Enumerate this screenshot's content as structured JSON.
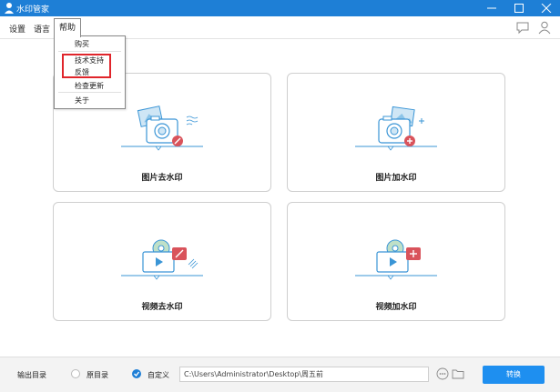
{
  "window": {
    "title": "水印管家"
  },
  "menu": {
    "settings": "设置",
    "language": "语言",
    "help": "帮助",
    "help_items": [
      "购买",
      "技术支持",
      "反馈",
      "检查更新",
      "关于"
    ]
  },
  "cards": [
    {
      "label": "图片去水印",
      "icon": "photo-remove-watermark-icon"
    },
    {
      "label": "图片加水印",
      "icon": "photo-add-watermark-icon"
    },
    {
      "label": "视频去水印",
      "icon": "video-remove-watermark-icon"
    },
    {
      "label": "视频加水印",
      "icon": "video-add-watermark-icon"
    }
  ],
  "output": {
    "label": "输出目录",
    "option_original": "原目录",
    "option_custom": "自定义",
    "selected": "自定义",
    "path": "C:\\Users\\Administrator\\Desktop\\周五前"
  },
  "convert_button": "转换",
  "colors": {
    "titlebar": "#1e7fd6",
    "accent": "#1e8ff0",
    "highlight_box": "#e0252b",
    "icon_line": "#3a95d6",
    "icon_accent": "#d9535b"
  }
}
